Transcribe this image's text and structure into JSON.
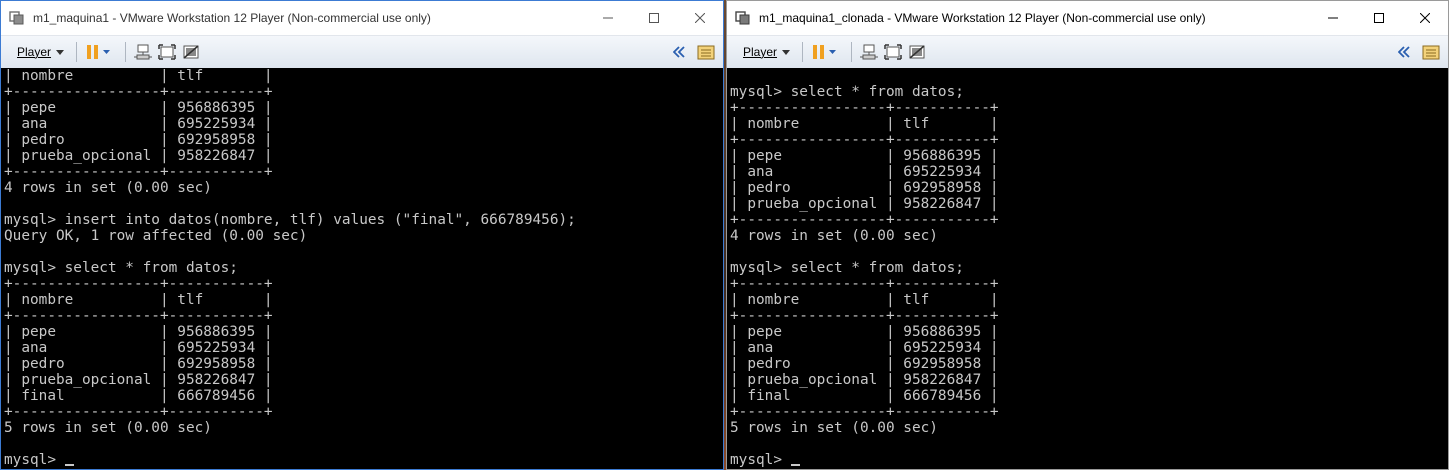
{
  "colors": {
    "console_bg": "#000000",
    "console_fg": "#c8c8c8",
    "titlebar_bg": "#ffffff",
    "toolbar_bg": "#e6ecf3",
    "active_border": "#3c7bd3",
    "pause_orange": "#f0a020"
  },
  "windows": {
    "left": {
      "title": "m1_maquina1 - VMware Workstation 12 Player (Non-commercial use only)",
      "player_menu": "Player",
      "console_lines": [
        "| nombre          | tlf       |",
        "+-----------------+-----------+",
        "| pepe            | 956886395 |",
        "| ana             | 695225934 |",
        "| pedro           | 692958958 |",
        "| prueba_opcional | 958226847 |",
        "+-----------------+-----------+",
        "4 rows in set (0.00 sec)",
        "",
        "mysql> insert into datos(nombre, tlf) values (\"final\", 666789456);",
        "Query OK, 1 row affected (0.00 sec)",
        "",
        "mysql> select * from datos;",
        "+-----------------+-----------+",
        "| nombre          | tlf       |",
        "+-----------------+-----------+",
        "| pepe            | 956886395 |",
        "| ana             | 695225934 |",
        "| pedro           | 692958958 |",
        "| prueba_opcional | 958226847 |",
        "| final           | 666789456 |",
        "+-----------------+-----------+",
        "5 rows in set (0.00 sec)",
        ""
      ],
      "prompt": "mysql> "
    },
    "right": {
      "title": "m1_maquina1_clonada - VMware Workstation 12 Player (Non-commercial use only)",
      "player_menu": "Player",
      "console_lines": [
        "mysql> select * from datos;",
        "+-----------------+-----------+",
        "| nombre          | tlf       |",
        "+-----------------+-----------+",
        "| pepe            | 956886395 |",
        "| ana             | 695225934 |",
        "| pedro           | 692958958 |",
        "| prueba_opcional | 958226847 |",
        "+-----------------+-----------+",
        "4 rows in set (0.00 sec)",
        "",
        "mysql> select * from datos;",
        "+-----------------+-----------+",
        "| nombre          | tlf       |",
        "+-----------------+-----------+",
        "| pepe            | 956886395 |",
        "| ana             | 695225934 |",
        "| pedro           | 692958958 |",
        "| prueba_opcional | 958226847 |",
        "| final           | 666789456 |",
        "+-----------------+-----------+",
        "5 rows in set (0.00 sec)",
        ""
      ],
      "prompt": "mysql> "
    }
  },
  "icons": {
    "app": "vmware-app-icon",
    "minimize": "minimize-icon",
    "maximize": "maximize-icon",
    "close": "close-icon",
    "pause": "pause-icon",
    "send_keys": "send-ctrl-alt-del-icon",
    "fit_guest": "fit-guest-icon",
    "unity": "unity-icon",
    "collapse": "double-chevron-left-icon",
    "library": "library-folder-icon"
  }
}
